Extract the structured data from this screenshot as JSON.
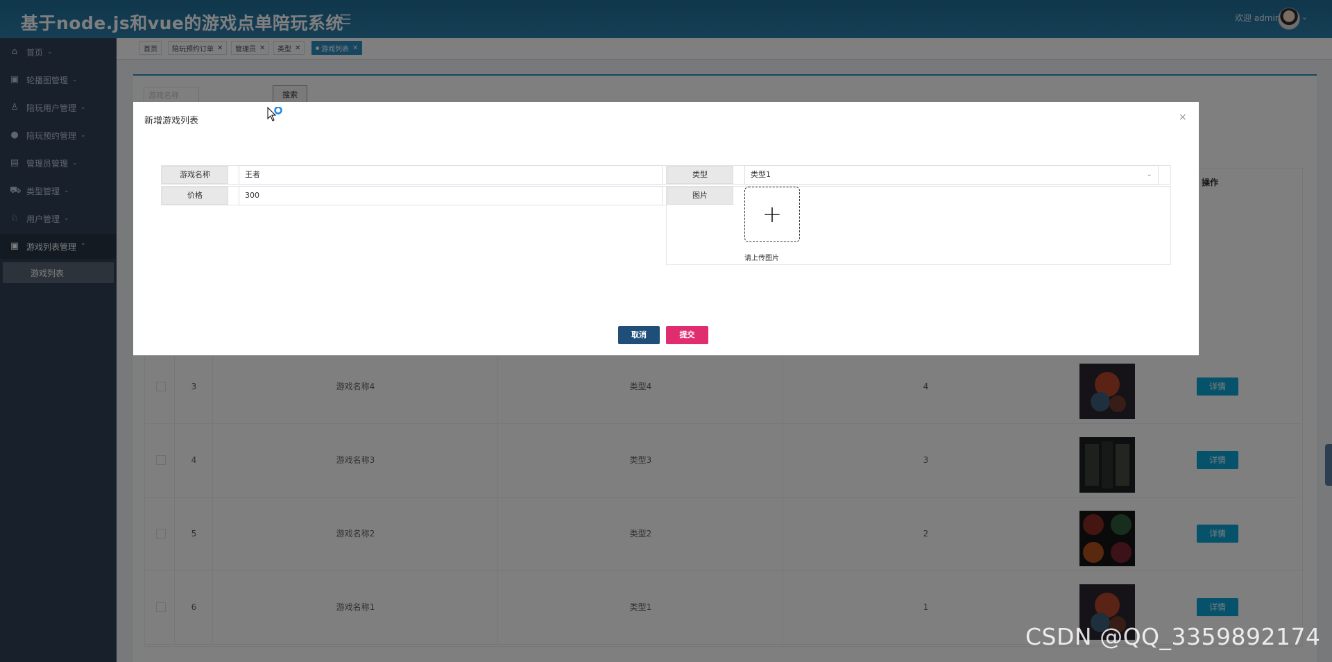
{
  "header": {
    "title": "基于node.js和vue的游戏点单陪玩系统",
    "menu_toggle_icon": "hamburger-icon",
    "welcome": "欢迎 admin"
  },
  "sidebar": {
    "items": [
      {
        "label": "首页",
        "icon": "home-icon",
        "expanded": false
      },
      {
        "label": "轮播图管理",
        "icon": "image-icon",
        "expanded": false
      },
      {
        "label": "陪玩用户管理",
        "icon": "user-icon",
        "expanded": false
      },
      {
        "label": "陪玩预约管理",
        "icon": "check-circle-icon",
        "expanded": false
      },
      {
        "label": "管理员管理",
        "icon": "admin-icon",
        "expanded": false
      },
      {
        "label": "类型管理",
        "icon": "category-icon",
        "expanded": false
      },
      {
        "label": "用户管理",
        "icon": "person-icon",
        "expanded": false
      },
      {
        "label": "游戏列表管理",
        "icon": "list-icon",
        "expanded": true
      }
    ],
    "subitem": "游戏列表"
  },
  "tags": [
    {
      "label": "首页",
      "closable": false,
      "active": false
    },
    {
      "label": "陪玩预约订单",
      "closable": true,
      "active": false
    },
    {
      "label": "管理员",
      "closable": true,
      "active": false
    },
    {
      "label": "类型",
      "closable": true,
      "active": false
    },
    {
      "label": "游戏列表",
      "closable": true,
      "active": true
    }
  ],
  "search": {
    "placeholder": "游戏名称",
    "button": "搜索"
  },
  "table": {
    "op_header": "操作",
    "detail_label": "详情",
    "rows": [
      {
        "index": "3",
        "name": "游戏名称4",
        "type": "类型4",
        "price": "4"
      },
      {
        "index": "4",
        "name": "游戏名称3",
        "type": "类型3",
        "price": "3"
      },
      {
        "index": "5",
        "name": "游戏名称2",
        "type": "类型2",
        "price": "2"
      },
      {
        "index": "6",
        "name": "游戏名称1",
        "type": "类型1",
        "price": "1"
      }
    ]
  },
  "dialog": {
    "title": "新增游戏列表",
    "close": "×",
    "fields": {
      "name_label": "游戏名称",
      "name_value": "王者",
      "type_label": "类型",
      "type_value": "类型1",
      "price_label": "价格",
      "price_value": "300",
      "image_label": "图片",
      "upload_tip": "请上传图片"
    },
    "cancel": "取消",
    "submit": "提交"
  },
  "watermark": "CSDN @QQ_3359892174",
  "colors": {
    "header": "#2c7eaa",
    "sidebar": "#304156",
    "detail_button": "#0ba4d4",
    "cancel_button": "#1f4e79",
    "submit_button": "#e02d6f"
  }
}
